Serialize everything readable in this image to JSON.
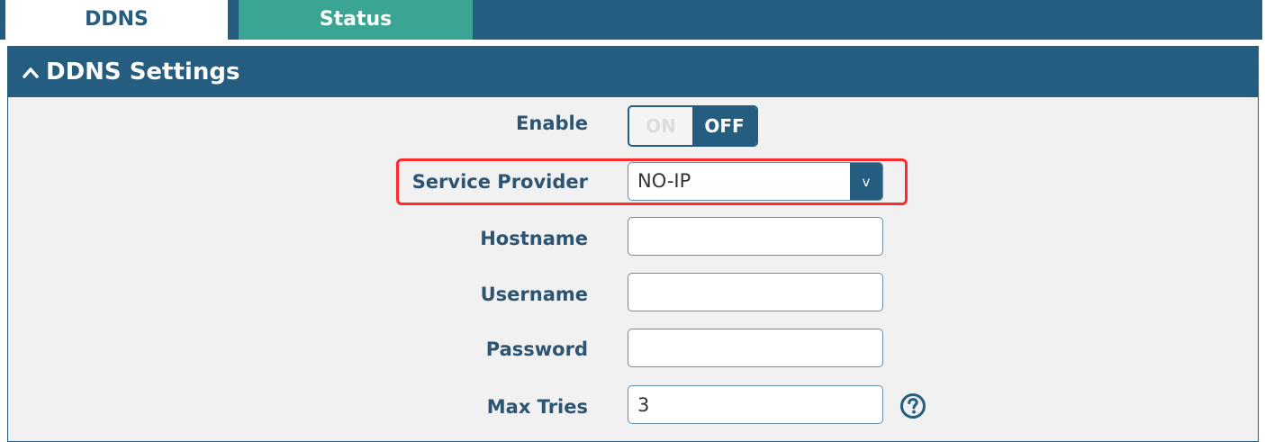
{
  "tabs": [
    {
      "label": "DDNS",
      "active": true
    },
    {
      "label": "Status",
      "active": false
    }
  ],
  "panel": {
    "title": "DDNS Settings"
  },
  "form": {
    "enable": {
      "label": "Enable",
      "on_label": "ON",
      "off_label": "OFF",
      "state": "off"
    },
    "service_provider": {
      "label": "Service Provider",
      "value": "NO-IP",
      "arrow": "v"
    },
    "hostname": {
      "label": "Hostname",
      "value": ""
    },
    "username": {
      "label": "Username",
      "value": ""
    },
    "password": {
      "label": "Password",
      "value": ""
    },
    "max_tries": {
      "label": "Max Tries",
      "value": "3"
    }
  },
  "colors": {
    "primary": "#255d80",
    "accent": "#3aa592",
    "highlight": "#ff2b2b",
    "panel_bg": "#f1f1f1"
  },
  "icons": {
    "collapse": "caret-up-icon",
    "help": "help-icon",
    "dropdown": "chevron-down-icon"
  }
}
